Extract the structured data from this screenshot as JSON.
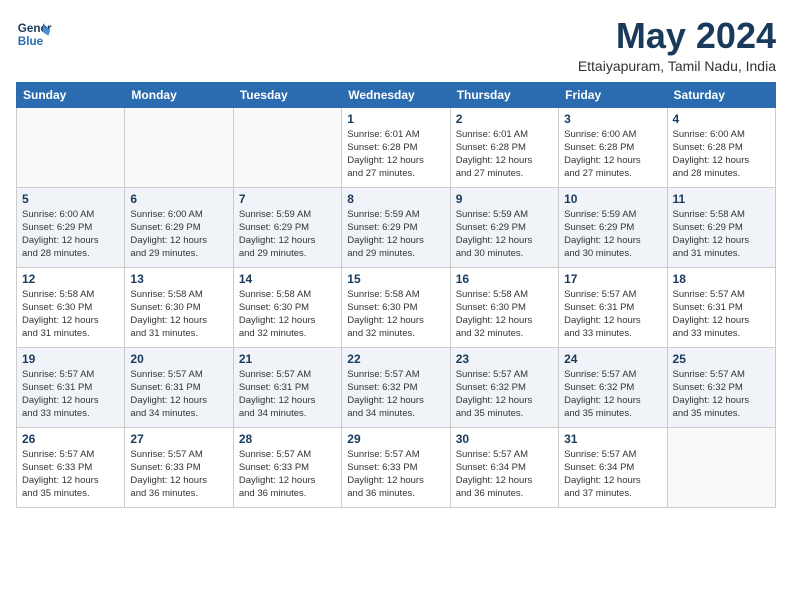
{
  "header": {
    "logo_line1": "General",
    "logo_line2": "Blue",
    "month_title": "May 2024",
    "location": "Ettaiyapuram, Tamil Nadu, India"
  },
  "weekdays": [
    "Sunday",
    "Monday",
    "Tuesday",
    "Wednesday",
    "Thursday",
    "Friday",
    "Saturday"
  ],
  "weeks": [
    {
      "shaded": false,
      "days": [
        {
          "num": "",
          "info": ""
        },
        {
          "num": "",
          "info": ""
        },
        {
          "num": "",
          "info": ""
        },
        {
          "num": "1",
          "info": "Sunrise: 6:01 AM\nSunset: 6:28 PM\nDaylight: 12 hours\nand 27 minutes."
        },
        {
          "num": "2",
          "info": "Sunrise: 6:01 AM\nSunset: 6:28 PM\nDaylight: 12 hours\nand 27 minutes."
        },
        {
          "num": "3",
          "info": "Sunrise: 6:00 AM\nSunset: 6:28 PM\nDaylight: 12 hours\nand 27 minutes."
        },
        {
          "num": "4",
          "info": "Sunrise: 6:00 AM\nSunset: 6:28 PM\nDaylight: 12 hours\nand 28 minutes."
        }
      ]
    },
    {
      "shaded": true,
      "days": [
        {
          "num": "5",
          "info": "Sunrise: 6:00 AM\nSunset: 6:29 PM\nDaylight: 12 hours\nand 28 minutes."
        },
        {
          "num": "6",
          "info": "Sunrise: 6:00 AM\nSunset: 6:29 PM\nDaylight: 12 hours\nand 29 minutes."
        },
        {
          "num": "7",
          "info": "Sunrise: 5:59 AM\nSunset: 6:29 PM\nDaylight: 12 hours\nand 29 minutes."
        },
        {
          "num": "8",
          "info": "Sunrise: 5:59 AM\nSunset: 6:29 PM\nDaylight: 12 hours\nand 29 minutes."
        },
        {
          "num": "9",
          "info": "Sunrise: 5:59 AM\nSunset: 6:29 PM\nDaylight: 12 hours\nand 30 minutes."
        },
        {
          "num": "10",
          "info": "Sunrise: 5:59 AM\nSunset: 6:29 PM\nDaylight: 12 hours\nand 30 minutes."
        },
        {
          "num": "11",
          "info": "Sunrise: 5:58 AM\nSunset: 6:29 PM\nDaylight: 12 hours\nand 31 minutes."
        }
      ]
    },
    {
      "shaded": false,
      "days": [
        {
          "num": "12",
          "info": "Sunrise: 5:58 AM\nSunset: 6:30 PM\nDaylight: 12 hours\nand 31 minutes."
        },
        {
          "num": "13",
          "info": "Sunrise: 5:58 AM\nSunset: 6:30 PM\nDaylight: 12 hours\nand 31 minutes."
        },
        {
          "num": "14",
          "info": "Sunrise: 5:58 AM\nSunset: 6:30 PM\nDaylight: 12 hours\nand 32 minutes."
        },
        {
          "num": "15",
          "info": "Sunrise: 5:58 AM\nSunset: 6:30 PM\nDaylight: 12 hours\nand 32 minutes."
        },
        {
          "num": "16",
          "info": "Sunrise: 5:58 AM\nSunset: 6:30 PM\nDaylight: 12 hours\nand 32 minutes."
        },
        {
          "num": "17",
          "info": "Sunrise: 5:57 AM\nSunset: 6:31 PM\nDaylight: 12 hours\nand 33 minutes."
        },
        {
          "num": "18",
          "info": "Sunrise: 5:57 AM\nSunset: 6:31 PM\nDaylight: 12 hours\nand 33 minutes."
        }
      ]
    },
    {
      "shaded": true,
      "days": [
        {
          "num": "19",
          "info": "Sunrise: 5:57 AM\nSunset: 6:31 PM\nDaylight: 12 hours\nand 33 minutes."
        },
        {
          "num": "20",
          "info": "Sunrise: 5:57 AM\nSunset: 6:31 PM\nDaylight: 12 hours\nand 34 minutes."
        },
        {
          "num": "21",
          "info": "Sunrise: 5:57 AM\nSunset: 6:31 PM\nDaylight: 12 hours\nand 34 minutes."
        },
        {
          "num": "22",
          "info": "Sunrise: 5:57 AM\nSunset: 6:32 PM\nDaylight: 12 hours\nand 34 minutes."
        },
        {
          "num": "23",
          "info": "Sunrise: 5:57 AM\nSunset: 6:32 PM\nDaylight: 12 hours\nand 35 minutes."
        },
        {
          "num": "24",
          "info": "Sunrise: 5:57 AM\nSunset: 6:32 PM\nDaylight: 12 hours\nand 35 minutes."
        },
        {
          "num": "25",
          "info": "Sunrise: 5:57 AM\nSunset: 6:32 PM\nDaylight: 12 hours\nand 35 minutes."
        }
      ]
    },
    {
      "shaded": false,
      "days": [
        {
          "num": "26",
          "info": "Sunrise: 5:57 AM\nSunset: 6:33 PM\nDaylight: 12 hours\nand 35 minutes."
        },
        {
          "num": "27",
          "info": "Sunrise: 5:57 AM\nSunset: 6:33 PM\nDaylight: 12 hours\nand 36 minutes."
        },
        {
          "num": "28",
          "info": "Sunrise: 5:57 AM\nSunset: 6:33 PM\nDaylight: 12 hours\nand 36 minutes."
        },
        {
          "num": "29",
          "info": "Sunrise: 5:57 AM\nSunset: 6:33 PM\nDaylight: 12 hours\nand 36 minutes."
        },
        {
          "num": "30",
          "info": "Sunrise: 5:57 AM\nSunset: 6:34 PM\nDaylight: 12 hours\nand 36 minutes."
        },
        {
          "num": "31",
          "info": "Sunrise: 5:57 AM\nSunset: 6:34 PM\nDaylight: 12 hours\nand 37 minutes."
        },
        {
          "num": "",
          "info": ""
        }
      ]
    }
  ]
}
